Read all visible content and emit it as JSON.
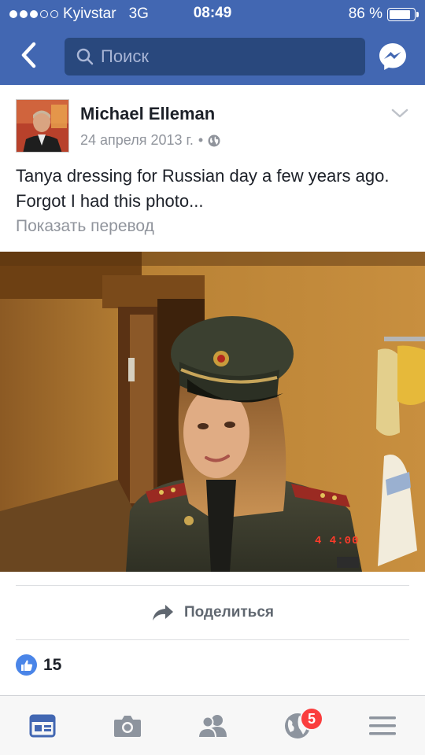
{
  "status_bar": {
    "carrier": "Kyivstar",
    "network": "3G",
    "time": "08:49",
    "battery_text": "86 %",
    "battery_level": 0.86,
    "signal_bars_filled": 3,
    "signal_bars_total": 5
  },
  "header": {
    "search_placeholder": "Поиск",
    "back_icon": "chevron-left-icon",
    "messenger_icon": "messenger-icon",
    "brand_color": "#4267b2"
  },
  "post": {
    "author": "Michael Elleman",
    "date": "24 апреля 2013 г.",
    "separator": "•",
    "privacy_icon": "globe-icon",
    "caption": "Tanya dressing for Russian day a few years ago.  Forgot I had this photo...",
    "translate_label": "Показать перевод",
    "photo_stamp": "4  4:00",
    "share_label": "Поделиться",
    "like_count": "15"
  },
  "tabbar": {
    "items": [
      {
        "name": "news-feed",
        "icon": "news-feed-icon",
        "active": true
      },
      {
        "name": "camera",
        "icon": "camera-icon",
        "active": false
      },
      {
        "name": "friends",
        "icon": "friends-icon",
        "active": false
      },
      {
        "name": "notifications",
        "icon": "globe-icon",
        "active": false
      },
      {
        "name": "menu",
        "icon": "menu-icon",
        "active": false
      }
    ],
    "notification_badge": "5"
  }
}
